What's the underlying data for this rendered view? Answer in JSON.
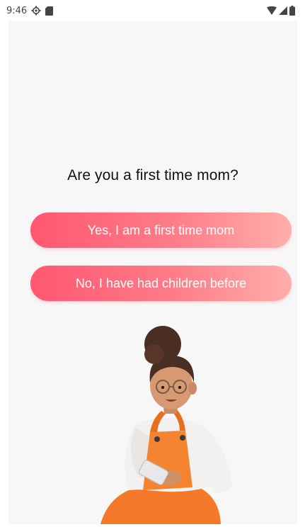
{
  "status_bar": {
    "time": "9:46",
    "left_icons": [
      "settings-gear-icon",
      "sd-card-icon"
    ],
    "right_icons": [
      "wifi-icon",
      "cellular-signal-icon",
      "battery-icon"
    ]
  },
  "question": {
    "title": "Are you a first time mom?"
  },
  "options": {
    "yes_label": "Yes, I am a first time mom",
    "no_label": "No, I have had children before"
  },
  "colors": {
    "button_gradient_start": "#ff5771",
    "button_gradient_end": "#ffaeac",
    "background": "#f7f7f8"
  },
  "illustration": {
    "icon": "mother-with-phone-illustration"
  }
}
